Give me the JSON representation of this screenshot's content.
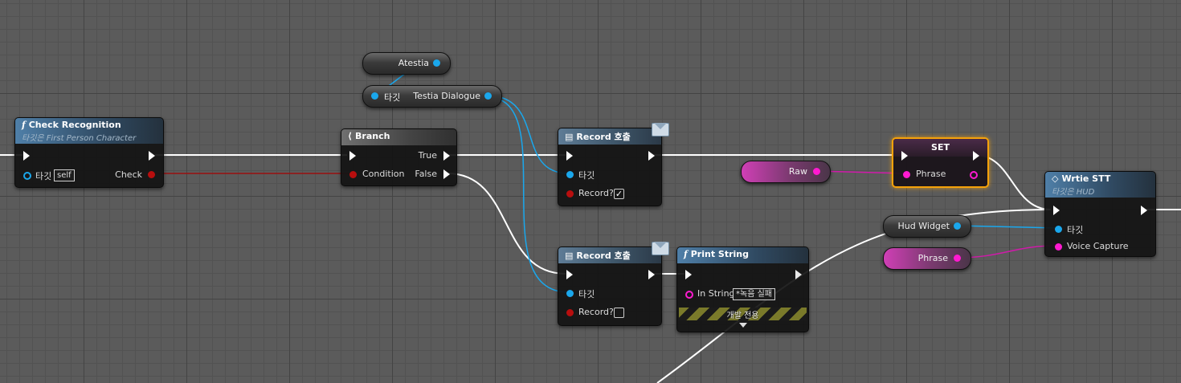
{
  "colors": {
    "exec_wire": "#ffffff",
    "object_pin": "#1aa7ec",
    "string_pin": "#ff1ad0",
    "bool_pin": "#b80e0e",
    "selected": "#f5a20a"
  },
  "nodes": {
    "check_recognition": {
      "title": "Check Recognition",
      "subtitle": "타깃은 First Person Character",
      "target_label": "타깃",
      "target_value": "self",
      "output_label": "Check",
      "icon": "function-icon"
    },
    "branch": {
      "title": "Branch",
      "condition_label": "Condition",
      "true_label": "True",
      "false_label": "False",
      "icon": "branch-icon"
    },
    "record_top": {
      "title": "Record 호출",
      "target_label": "타깃",
      "record_label": "Record?",
      "record_checked": "✓",
      "icon": "event-icon"
    },
    "record_bottom": {
      "title": "Record 호출",
      "target_label": "타깃",
      "record_label": "Record?",
      "record_checked": "",
      "icon": "event-icon"
    },
    "print_string": {
      "title": "Print String",
      "in_string_label": "In String",
      "in_string_value": "*녹음 실패",
      "dev_only_label": "개발 전용",
      "icon": "function-icon"
    },
    "set": {
      "title": "SET",
      "phrase_label": "Phrase"
    },
    "write_stt": {
      "title": "Wrtie STT",
      "subtitle": "타깃은 HUD",
      "target_label": "타깃",
      "voice_label": "Voice Capture",
      "icon": "function-icon"
    }
  },
  "variables": {
    "atestia": "Atestia",
    "testia_dialogue_target": "타깃",
    "testia_dialogue": "Testia Dialogue",
    "raw": "Raw",
    "hud_widget": "Hud Widget",
    "phrase": "Phrase"
  }
}
